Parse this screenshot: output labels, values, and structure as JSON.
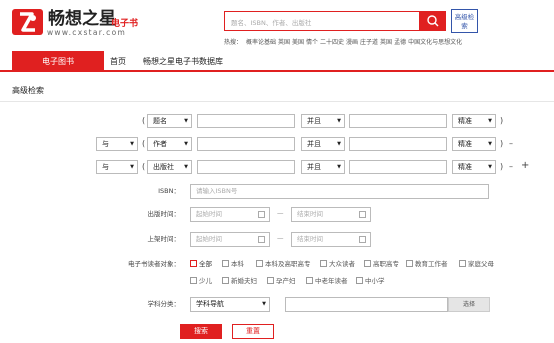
{
  "brand": {
    "name": "畅想之星",
    "sub": "电子书",
    "url": "www.cxstar.com"
  },
  "search": {
    "placeholder": "题名、ISBN、作者、出版社",
    "adv_label": "高级检索"
  },
  "hot_label": "热搜：",
  "hot_words": [
    "概率论基础",
    "英国",
    "美国",
    "情个",
    "二十四史",
    "漫画",
    "庄子道",
    "英国",
    "孟德",
    "中国文化与思想文化"
  ],
  "nav": {
    "active": "电子图书",
    "items": [
      "首页",
      "畅想之星电子书数据库"
    ]
  },
  "panel_title": "高级检索",
  "rows": [
    {
      "op": "",
      "field": "题名",
      "match": "并且",
      "exact": "精准"
    },
    {
      "op": "与",
      "field": "作者",
      "match": "并且",
      "exact": "精准"
    },
    {
      "op": "与",
      "field": "出版社",
      "match": "并且",
      "exact": "精准"
    }
  ],
  "minus": "–",
  "plus": "+",
  "paren_open": "(",
  "paren_close": ")",
  "isbn": {
    "label": "ISBN：",
    "placeholder": "请输入ISBN号"
  },
  "pub_time": {
    "label": "出版时间：",
    "start": "起始时间",
    "end": "结束时间"
  },
  "shelf_time": {
    "label": "上架时间：",
    "start": "起始时间",
    "end": "结束时间"
  },
  "dash": "—",
  "reader": {
    "label": "电子书读者对象：",
    "options": [
      "全部",
      "本科",
      "本科及高职高专",
      "大众读者",
      "高职高专",
      "教育工作者",
      "家庭父母",
      "少儿",
      "新婚夫妇",
      "孕产妇",
      "中老年读者",
      "中小学"
    ],
    "checked": "全部"
  },
  "subject": {
    "label": "学科分类：",
    "value": "学科导航",
    "select_label": "选择"
  },
  "buttons": {
    "search": "搜索",
    "reset": "重置"
  }
}
